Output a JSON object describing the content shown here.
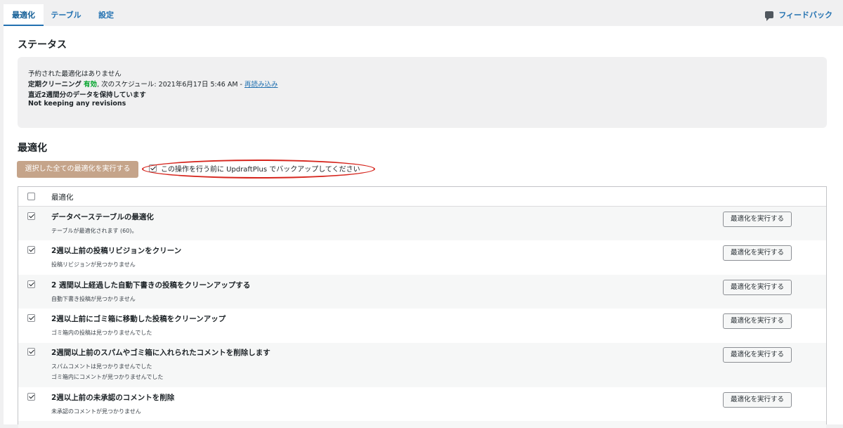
{
  "tabs": [
    {
      "label": "最適化",
      "active": true
    },
    {
      "label": "テーブル",
      "active": false
    },
    {
      "label": "設定",
      "active": false
    }
  ],
  "feedback_label": "フィードバック",
  "status": {
    "heading": "ステータス",
    "line1": "予約された最適化はありません",
    "line2_label": "定期クリーニング",
    "line2_enabled": "有効",
    "line2_rest": ", 次のスケジュール: 2021年6月17日 5:46 AM - ",
    "line2_link": "再読み込み",
    "line3": "直近2週間分のデータを保持しています",
    "line4": "Not keeping any revisions"
  },
  "optimize": {
    "heading": "最適化",
    "run_all_label": "選択した全ての最適化を実行する",
    "backup_label": "この操作を行う前に UpdraftPlus でバックアップしてください",
    "backup_checked": true,
    "column_header": "最適化",
    "run_label": "最適化を実行する",
    "rows": [
      {
        "title": "データベーステーブルの最適化",
        "desc": [
          "テーブルが最適化されます (60)。"
        ],
        "checked": true
      },
      {
        "title": "2週以上前の投稿リビジョンをクリーン",
        "desc": [
          "投稿リビジョンが見つかりません"
        ],
        "checked": true
      },
      {
        "title": "2 週間以上経過した自動下書きの投稿をクリーンアップする",
        "desc": [
          "自動下書き投稿が見つかりません"
        ],
        "checked": true
      },
      {
        "title": "2週以上前にゴミ箱に移動した投稿をクリーンアップ",
        "desc": [
          "ゴミ箱内の投稿は見つかりませんでした"
        ],
        "checked": true
      },
      {
        "title": "2週間以上前のスパムやゴミ箱に入れられたコメントを削除します",
        "desc": [
          "スパムコメントは見つかりませんでした",
          "ゴミ箱内にコメントが見つかりませんでした"
        ],
        "checked": true
      },
      {
        "title": "2週以上前の未承認のコメントを削除",
        "desc": [
          "未承認のコメントが見つかりません"
        ],
        "checked": true
      }
    ]
  },
  "colors": {
    "accent": "#2271b1",
    "enabled": "#00a32a",
    "run_all_bg": "#c5a48a",
    "highlight": "#d6251d"
  }
}
